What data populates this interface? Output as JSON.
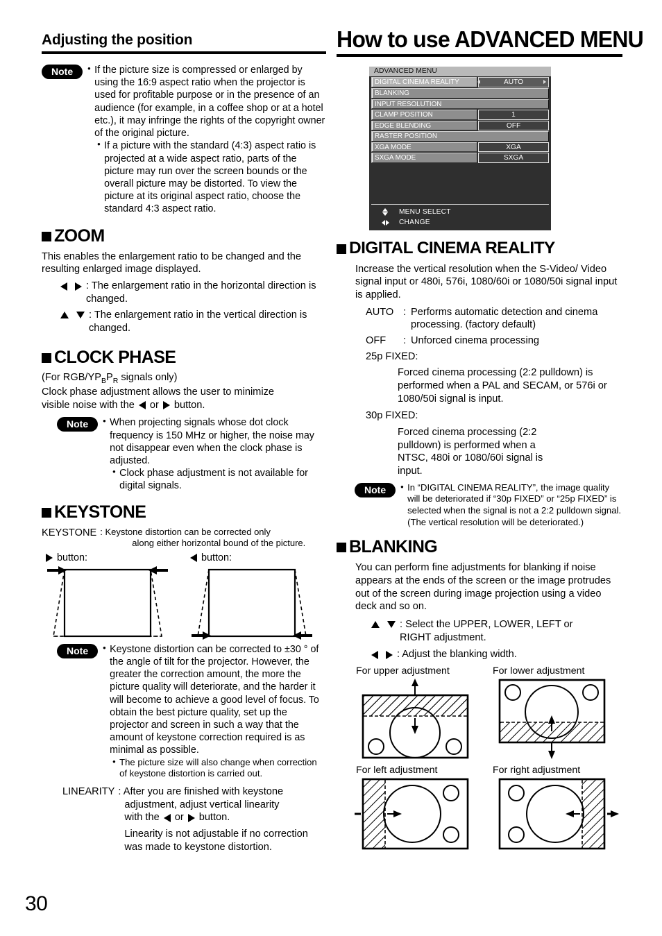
{
  "page": {
    "number": "30"
  },
  "left": {
    "section_heading": "Adjusting the position",
    "note1": {
      "label": "Note",
      "items": [
        "If the picture size is compressed or enlarged by using the 16:9 aspect ratio when the projector is used for profitable purpose or in the presence of an audience (for example, in a coffee shop or at a hotel etc.), it may infringe the rights of the copyright owner of the original picture.",
        "If a picture with the standard (4:3) aspect ratio is projected at a wide aspect ratio, parts of the picture may run over the screen bounds or the overall picture may be distorted. To view the picture at its original aspect ratio, choose the standard 4:3 aspect ratio."
      ]
    },
    "zoom": {
      "heading": "ZOOM",
      "body": "This enables the enlargement ratio to be changed and the resulting enlarged image displayed.",
      "keys": [
        {
          "icons": "left-right",
          "text": ": The enlargement ratio in the horizontal direction is changed."
        },
        {
          "icons": "up-down",
          "text": ": The enlargement ratio in the vertical direction is changed."
        }
      ]
    },
    "clock_phase": {
      "heading": "CLOCK PHASE",
      "line1_pre": "(For RGB/YP",
      "line1_sub1": "B",
      "line1_mid": "P",
      "line1_sub2": "R",
      "line1_post": " signals only)",
      "line2": "Clock phase adjustment allows the user to minimize",
      "line3_pre": "visible noise with the",
      "line3_mid": "or",
      "line3_post": "button.",
      "note": {
        "label": "Note",
        "items": [
          "When projecting signals whose dot clock frequency is 150 MHz or higher, the noise may not disappear even when the clock phase is adjusted.",
          "Clock phase adjustment is not available for digital signals."
        ]
      }
    },
    "keystone": {
      "heading": "KEYSTONE",
      "term": "KEYSTONE",
      "def_line1": ": Keystone distortion can be corrected only",
      "def_line2": "along either horizontal bound of the picture.",
      "fig_right_caption": "button:",
      "fig_left_caption": "button:",
      "note": {
        "label": "Note",
        "items": [
          "Keystone distortion can be corrected to ±30 ° of the angle of tilt for the projector. However, the greater the correction amount, the more the picture quality will deteriorate, and the harder it will become to achieve a good level of focus. To obtain the best picture quality, set up the projector and screen in such a way that the amount of keystone correction required is as minimal as possible.",
          "The picture size will also change when correction of keystone distortion is carried out."
        ]
      },
      "linearity_term": "LINEARITY",
      "linearity_line1": ": After you are finished with keystone",
      "linearity_line2": "adjustment, adjust vertical linearity",
      "linearity_line3_pre": "with the",
      "linearity_line3_mid": "or",
      "linearity_line3_post": "button.",
      "linearity_line4": "Linearity is not adjustable if no correction",
      "linearity_line5": "was made to keystone distortion."
    }
  },
  "right": {
    "main_heading": "How to use ADVANCED MENU",
    "osd": {
      "title": "ADVANCED MENU",
      "rows": [
        {
          "label": "DIGITAL CINEMA REALITY",
          "value": "AUTO",
          "selected": true,
          "wide": false
        },
        {
          "label": "BLANKING",
          "value": "",
          "selected": false,
          "wide": true
        },
        {
          "label": "INPUT RESOLUTION",
          "value": "",
          "selected": false,
          "wide": true
        },
        {
          "label": "CLAMP POSITION",
          "value": "1",
          "selected": false,
          "wide": false
        },
        {
          "label": "EDGE BLENDING",
          "value": "OFF",
          "selected": false,
          "wide": false
        },
        {
          "label": "RASTER POSITION",
          "value": "",
          "selected": false,
          "wide": true
        },
        {
          "label": "XGA MODE",
          "value": "XGA",
          "selected": false,
          "wide": false
        },
        {
          "label": "SXGA MODE",
          "value": "SXGA",
          "selected": false,
          "wide": false
        }
      ],
      "footer": [
        {
          "icon": "up-down-arrows",
          "text": "MENU SELECT"
        },
        {
          "icon": "left-right-arrows",
          "text": "CHANGE"
        }
      ]
    },
    "digital_cinema_reality": {
      "heading": "DIGITAL CINEMA REALITY",
      "body": "Increase the vertical resolution when the S-Video/ Video signal input or 480i, 576i, 1080/60i or 1080/50i signal input is applied.",
      "options": [
        {
          "name": "AUTO",
          "sep": ":",
          "text": "Performs automatic detection and cinema processing. (factory default)"
        },
        {
          "name": "OFF",
          "sep": ":",
          "text": "Unforced cinema processing"
        }
      ],
      "fixed": [
        {
          "name": "25p FIXED:",
          "text": "Forced cinema processing (2:2 pulldown) is performed when a PAL and SECAM, or 576i or 1080/50i signal is input."
        },
        {
          "name": "30p FIXED:",
          "text": "Forced cinema processing (2:2 pulldown) is performed when a NTSC, 480i or 1080/60i signal is input."
        }
      ],
      "note": {
        "label": "Note",
        "items": [
          "In “DIGITAL CINEMA REALITY”, the image quality will be deteriorated if “30p FIXED” or “25p FIXED” is selected when the signal is not a 2:2 pulldown signal. (The vertical resolution will be deteriorated.)"
        ]
      }
    },
    "blanking": {
      "heading": "BLANKING",
      "body": "You can perform fine adjustments for blanking if noise appears at the ends of the screen or the image protrudes out of the screen during image projection using a video deck and so on.",
      "keys": [
        {
          "icons": "up-down",
          "text": ": Select the UPPER, LOWER, LEFT or RIGHT adjustment."
        },
        {
          "icons": "left-right",
          "text": ": Adjust the blanking width."
        }
      ],
      "figures": [
        {
          "caption": "For upper adjustment"
        },
        {
          "caption": "For lower adjustment"
        },
        {
          "caption": "For left adjustment"
        },
        {
          "caption": "For right adjustment"
        }
      ]
    }
  }
}
